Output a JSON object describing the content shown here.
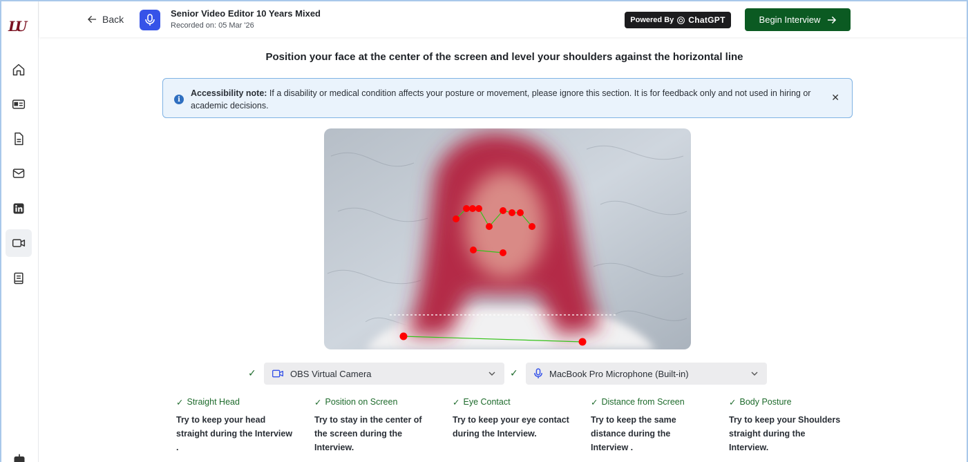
{
  "header": {
    "back_label": "Back",
    "title": "Senior Video Editor 10 Years Mixed",
    "subtitle": "Recorded on: 05 Mar '26",
    "powered_label": "Powered By",
    "powered_brand": "ChatGPT",
    "begin_label": "Begin Interview"
  },
  "sidebar": {
    "logo": "LU",
    "items": [
      {
        "icon": "home-icon"
      },
      {
        "icon": "id-card-icon"
      },
      {
        "icon": "document-icon"
      },
      {
        "icon": "mail-icon"
      },
      {
        "icon": "linkedin-icon"
      },
      {
        "icon": "video-icon",
        "active": true
      },
      {
        "icon": "book-icon"
      }
    ]
  },
  "main": {
    "instruction": "Position your face at the center of the screen and level your shoulders against the horizontal line",
    "note_bold": "Accessibility note:",
    "note_text": " If a disability or medical condition affects your posture or movement, please ignore this section. It is for feedback only and not used in hiring or academic decisions.",
    "camera_select": "OBS Virtual Camera",
    "mic_select": "MacBook Pro Microphone (Built-in)",
    "tips": [
      {
        "title": "Straight Head",
        "body": "Try to keep your head straight during the Interview ."
      },
      {
        "title": "Position on Screen",
        "body": "Try to stay in the center of the screen during the Interview."
      },
      {
        "title": "Eye Contact",
        "body": "Try to keep your eye contact during the Interview."
      },
      {
        "title": "Distance from Screen",
        "body": "Try to keep the same distance during the Interview ."
      },
      {
        "title": "Body Posture",
        "body": "Try to keep your Shoulders straight during the Interview."
      }
    ]
  },
  "colors": {
    "accent_green": "#0b5a22",
    "mic_blue": "#3653e8",
    "note_bg": "#eaf3fc",
    "landmark_red": "#ff0000",
    "landmark_line": "#35c21a"
  }
}
